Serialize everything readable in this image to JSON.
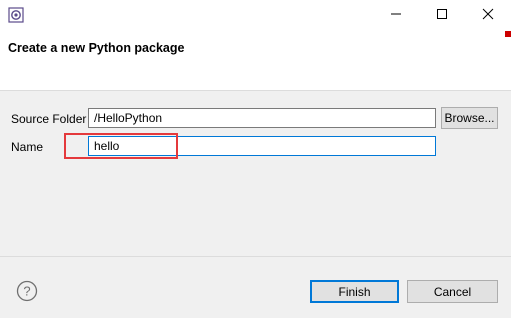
{
  "window": {
    "title": "",
    "icon": "eclipse-icon",
    "controls": {
      "minimize_icon": "minimize-icon",
      "maximize_icon": "maximize-icon",
      "close_icon": "close-icon"
    }
  },
  "header": {
    "title": "Create a new Python package"
  },
  "form": {
    "source_folder_label": "Source Folder",
    "source_folder_value": "/HelloPython",
    "browse_label": "Browse...",
    "name_label": "Name",
    "name_value": "hello"
  },
  "footer": {
    "help_icon": "help-icon",
    "finish_label": "Finish",
    "cancel_label": "Cancel"
  },
  "colors": {
    "highlight": "#e4393c",
    "focus": "#0078d7"
  }
}
